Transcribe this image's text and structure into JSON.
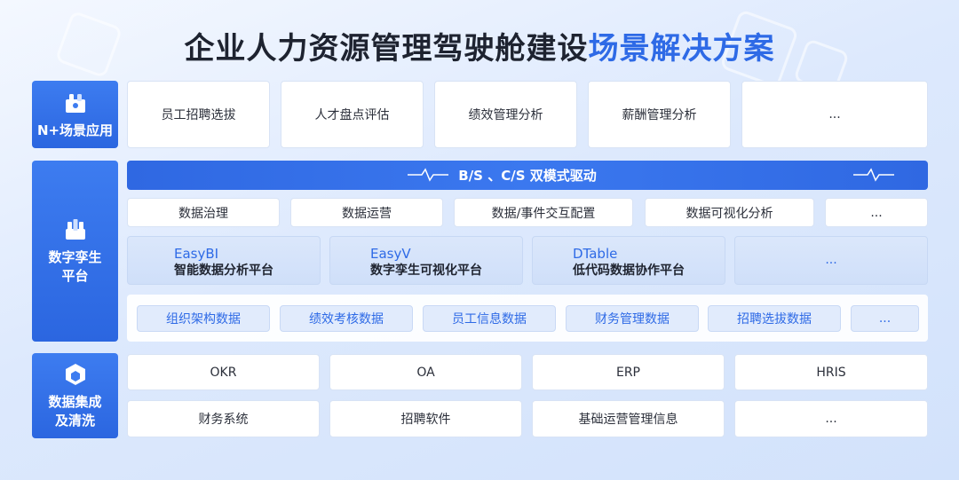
{
  "title": {
    "main": "企业人力资源管理驾驶舱建设",
    "highlight": "场景解决方案"
  },
  "colors": {
    "primary": "#2e6ae6",
    "label_bg": "#3372e8",
    "text": "#1e2330"
  },
  "row1": {
    "label": "N+场景应用",
    "icon": "puzzle-icon",
    "items": [
      "员工招聘选拔",
      "人才盘点评估",
      "绩效管理分析",
      "薪酬管理分析",
      "..."
    ]
  },
  "row2": {
    "label_line1": "数字孪生",
    "label_line2": "平台",
    "icon": "building-icon",
    "mode_bar": "B/S 、C/S 双模式驱动",
    "functions": [
      "数据治理",
      "数据运营",
      "数据/事件交互配置",
      "数据可视化分析",
      "..."
    ],
    "products": [
      {
        "en": "EasyBI",
        "cn": "智能数据分析平台"
      },
      {
        "en": "EasyV",
        "cn": "数字孪生可视化平台"
      },
      {
        "en": "DTable",
        "cn": "低代码数据协作平台"
      }
    ],
    "products_more": "...",
    "data_tags": [
      "组织架构数据",
      "绩效考核数据",
      "员工信息数据",
      "财务管理数据",
      "招聘选拔数据",
      "..."
    ]
  },
  "row3": {
    "label_line1": "数据集成",
    "label_line2": "及清洗",
    "icon": "cube-icon",
    "systems_row1": [
      "OKR",
      "OA",
      "ERP",
      "HRIS"
    ],
    "systems_row2": [
      "财务系统",
      "招聘软件",
      "基础运营管理信息",
      "..."
    ]
  }
}
